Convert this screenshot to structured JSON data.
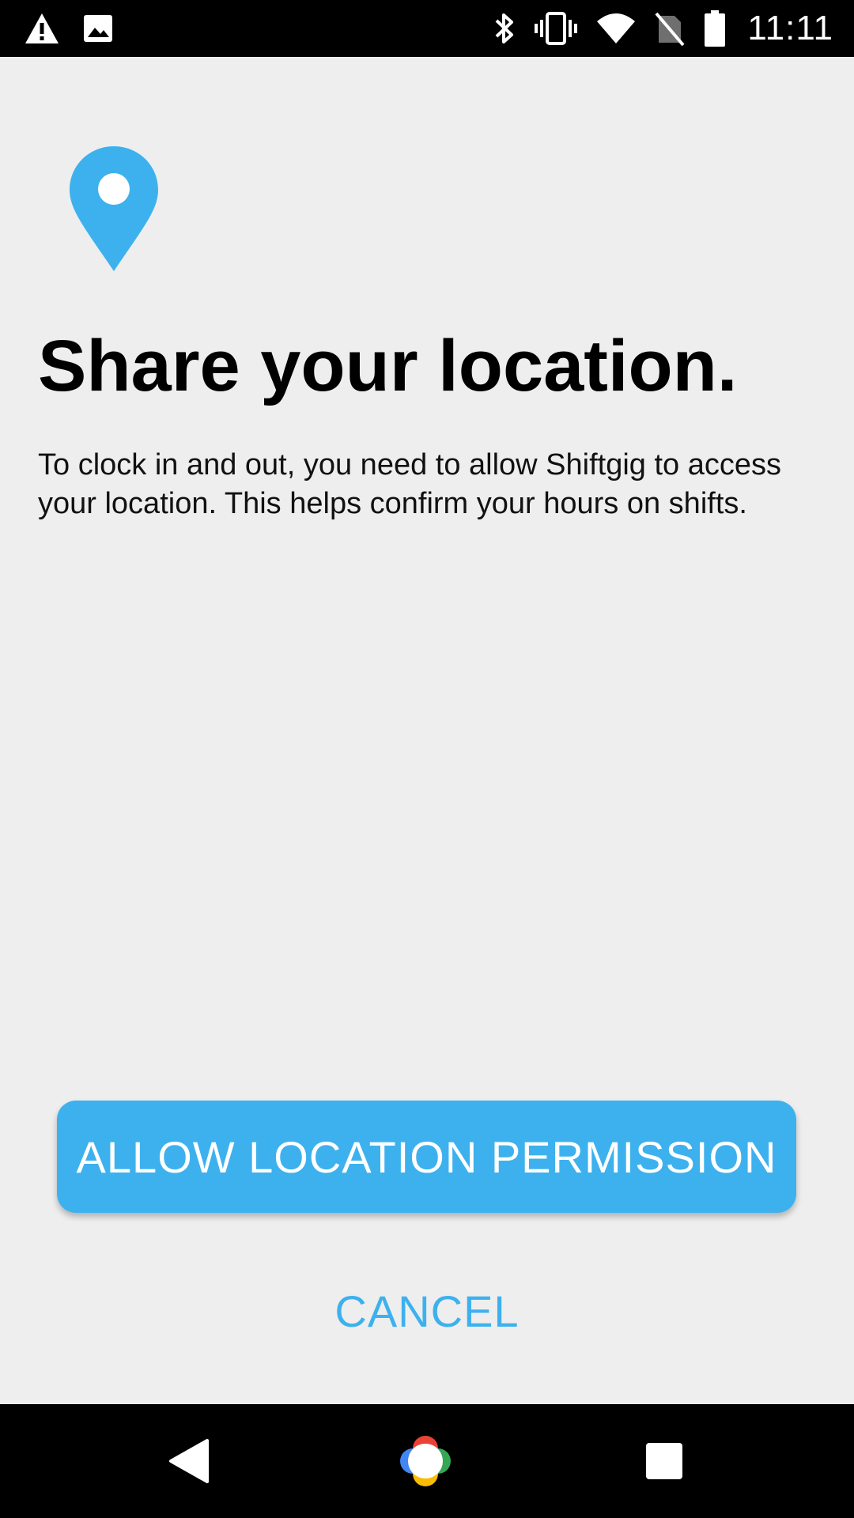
{
  "status_bar": {
    "time": "11:11",
    "left_icons": [
      "warning-icon",
      "image-icon"
    ],
    "right_icons": [
      "bluetooth-icon",
      "vibrate-icon",
      "wifi-icon",
      "no-sim-icon",
      "battery-icon"
    ]
  },
  "permission": {
    "icon": "location-pin-icon",
    "title": "Share your location.",
    "description": "To clock in and out, you need to allow Shiftgig to access your location. This helps confirm your hours on shifts.",
    "allow_label": "ALLOW LOCATION PERMISSION",
    "cancel_label": "CANCEL"
  },
  "nav_bar": {
    "buttons": [
      "back-icon",
      "home-icon",
      "recents-icon"
    ]
  },
  "colors": {
    "accent": "#3db1ee",
    "background": "#eeeeee",
    "bars": "#000000"
  }
}
